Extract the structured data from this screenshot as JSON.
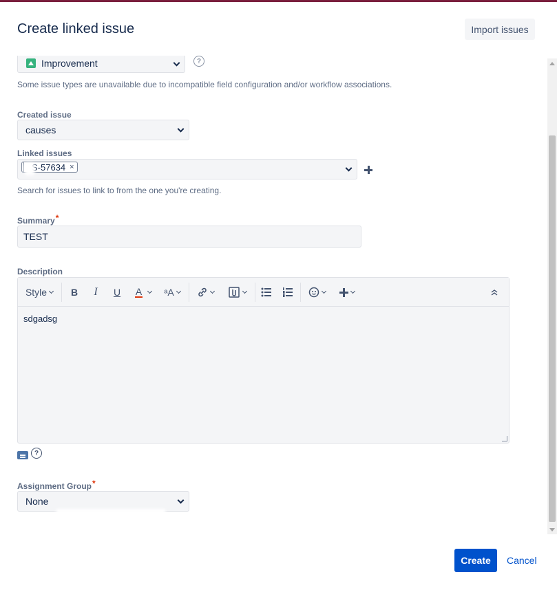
{
  "dialog": {
    "title": "Create linked issue",
    "import_button": "Import issues"
  },
  "issue_type": {
    "selected": "Improvement",
    "hint": "Some issue types are unavailable due to incompatible field configuration and/or workflow associations."
  },
  "created_issue": {
    "label": "Created issue",
    "selected": "causes"
  },
  "linked_issues": {
    "label": "Linked issues",
    "tag": "S-57634",
    "tag_remove": "×",
    "hint": "Search for issues to link to from the one you're creating."
  },
  "summary": {
    "label": "Summary",
    "required_mark": "*",
    "value": "TEST"
  },
  "description": {
    "label": "Description",
    "toolbar": {
      "style": "Style",
      "bold": "B",
      "italic": "I",
      "underline": "U",
      "text_color": "A",
      "text_size": "ᵃA"
    },
    "body": "sdgadsg"
  },
  "assignment_group": {
    "label": "Assignment Group",
    "required_mark": "*",
    "selected": "None"
  },
  "footer": {
    "create_button": "Create",
    "cancel_link": "Cancel"
  },
  "colors": {
    "primary": "#0052cc",
    "required": "#de350b",
    "improvement_icon": "#36b37e",
    "text_color_underline": "#de350b"
  }
}
